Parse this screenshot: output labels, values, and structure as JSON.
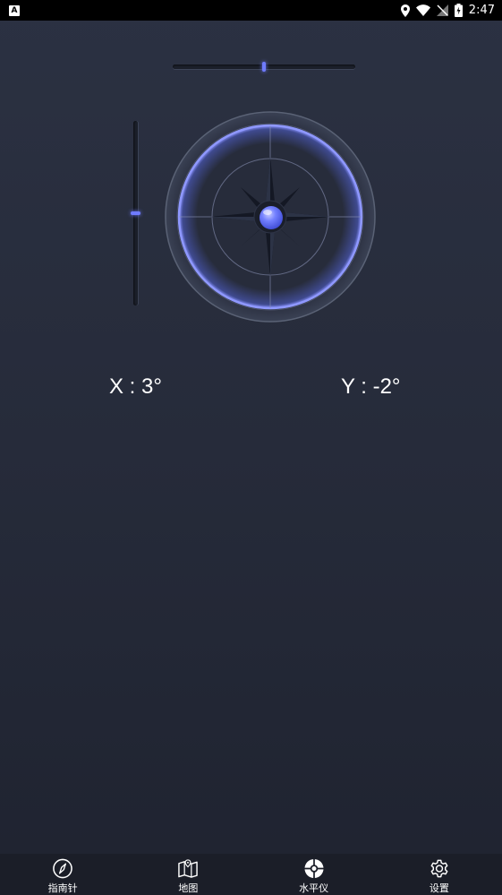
{
  "status_bar": {
    "notification_icon_letter": "A",
    "time": "2:47",
    "icons": [
      "location-icon",
      "wifi-icon",
      "no-signal-icon",
      "battery-charging-icon"
    ]
  },
  "level": {
    "horizontal_bubble_fraction": 0.5,
    "vertical_bubble_fraction": 0.5,
    "accent_color": "#6f7bff"
  },
  "readings": {
    "x": "X : 3°",
    "y": "Y : -2°"
  },
  "nav": {
    "items": [
      {
        "label": "指南针",
        "icon": "compass-icon"
      },
      {
        "label": "地图",
        "icon": "map-icon"
      },
      {
        "label": "水平仪",
        "icon": "level-icon",
        "active": true
      },
      {
        "label": "设置",
        "icon": "gear-icon"
      }
    ]
  }
}
